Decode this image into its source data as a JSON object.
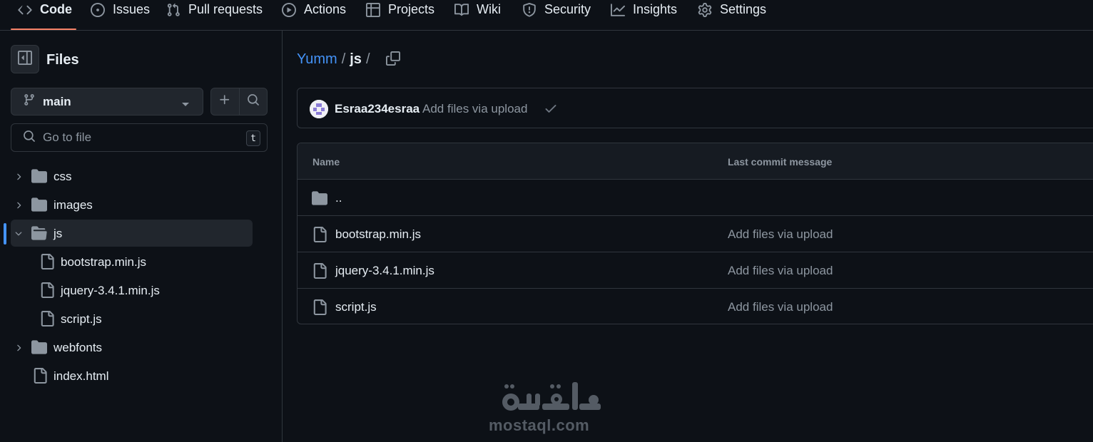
{
  "topnav": {
    "tabs": [
      {
        "label": "Code",
        "icon": "code-icon",
        "active": true
      },
      {
        "label": "Issues",
        "icon": "issue-icon"
      },
      {
        "label": "Pull requests",
        "icon": "pull-request-icon"
      },
      {
        "label": "Actions",
        "icon": "play-icon"
      },
      {
        "label": "Projects",
        "icon": "table-icon"
      },
      {
        "label": "Wiki",
        "icon": "book-icon"
      },
      {
        "label": "Security",
        "icon": "shield-icon"
      },
      {
        "label": "Insights",
        "icon": "graph-icon"
      },
      {
        "label": "Settings",
        "icon": "gear-icon"
      }
    ]
  },
  "sidebar": {
    "title": "Files",
    "branch": "main",
    "search_placeholder": "Go to file",
    "search_shortcut": "t",
    "tree": [
      {
        "name": "css",
        "type": "folder",
        "expanded": false
      },
      {
        "name": "images",
        "type": "folder",
        "expanded": false
      },
      {
        "name": "js",
        "type": "folder",
        "expanded": true,
        "selected": true
      },
      {
        "name": "bootstrap.min.js",
        "type": "file",
        "depth": 1
      },
      {
        "name": "jquery-3.4.1.min.js",
        "type": "file",
        "depth": 1
      },
      {
        "name": "script.js",
        "type": "file",
        "depth": 1
      },
      {
        "name": "webfonts",
        "type": "folder",
        "expanded": false
      },
      {
        "name": "index.html",
        "type": "file"
      }
    ]
  },
  "breadcrumb": {
    "repo": "Yumm",
    "separator": "/",
    "current": "js"
  },
  "commit": {
    "author": "Esraa234esraa",
    "message": "Add files via upload"
  },
  "table": {
    "headers": {
      "name": "Name",
      "last_commit": "Last commit message"
    },
    "parent": "..",
    "rows": [
      {
        "name": "bootstrap.min.js",
        "message": "Add files via upload"
      },
      {
        "name": "jquery-3.4.1.min.js",
        "message": "Add files via upload"
      },
      {
        "name": "script.js",
        "message": "Add files via upload"
      }
    ]
  },
  "watermark": {
    "arabic": "مستقل",
    "latin": "mostaql.com"
  },
  "colors": {
    "background": "#0d1117",
    "border": "#30363d",
    "link": "#4493f8",
    "muted": "#8d96a0",
    "active_underline": "#f78166"
  }
}
